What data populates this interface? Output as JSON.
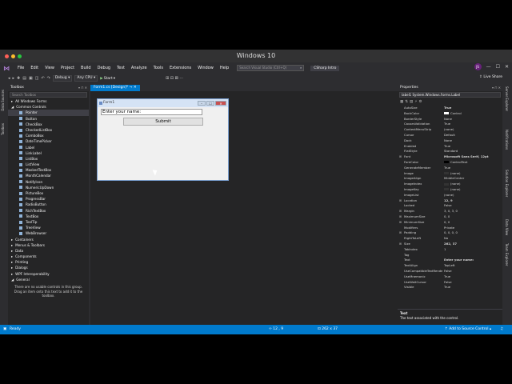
{
  "os": {
    "window_title": "Windows 10"
  },
  "colors": {
    "accent": "#007acc",
    "bg": "#2d2d30",
    "panel": "#252526"
  },
  "menu": {
    "logo_icon": "visual-studio-icon",
    "items": [
      "File",
      "Edit",
      "View",
      "Project",
      "Build",
      "Debug",
      "Test",
      "Analyze",
      "Tools",
      "Extensions",
      "Window",
      "Help"
    ],
    "search_placeholder": "Search Visual Studio (Ctrl+Q)",
    "solution_name": "CSharp Intro",
    "user_initials": "JS",
    "live_share": "Live Share"
  },
  "toolbar": {
    "config": "Debug",
    "platform": "Any CPU",
    "start_label": "Start"
  },
  "left_vertical_tabs": [
    "Data Sources",
    "Toolbox"
  ],
  "toolbox": {
    "title": "Toolbox",
    "search_placeholder": "Search Toolbox",
    "items": [
      {
        "label": "All Windows Forms",
        "level": 0,
        "expander": "▸"
      },
      {
        "label": "Common Controls",
        "level": 0,
        "expander": "◢"
      },
      {
        "label": "Pointer",
        "level": 1,
        "selected": true
      },
      {
        "label": "Button",
        "level": 1
      },
      {
        "label": "CheckBox",
        "level": 1
      },
      {
        "label": "CheckedListBox",
        "level": 1
      },
      {
        "label": "ComboBox",
        "level": 1
      },
      {
        "label": "DateTimePicker",
        "level": 1
      },
      {
        "label": "Label",
        "level": 1
      },
      {
        "label": "LinkLabel",
        "level": 1
      },
      {
        "label": "ListBox",
        "level": 1
      },
      {
        "label": "ListView",
        "level": 1
      },
      {
        "label": "MaskedTextBox",
        "level": 1
      },
      {
        "label": "MonthCalendar",
        "level": 1
      },
      {
        "label": "NotifyIcon",
        "level": 1
      },
      {
        "label": "NumericUpDown",
        "level": 1
      },
      {
        "label": "PictureBox",
        "level": 1
      },
      {
        "label": "ProgressBar",
        "level": 1
      },
      {
        "label": "RadioButton",
        "level": 1
      },
      {
        "label": "RichTextBox",
        "level": 1
      },
      {
        "label": "TextBox",
        "level": 1
      },
      {
        "label": "ToolTip",
        "level": 1
      },
      {
        "label": "TreeView",
        "level": 1
      },
      {
        "label": "WebBrowser",
        "level": 1
      },
      {
        "label": "Containers",
        "level": 0,
        "expander": "▸"
      },
      {
        "label": "Menus & Toolbars",
        "level": 0,
        "expander": "▸"
      },
      {
        "label": "Data",
        "level": 0,
        "expander": "▸"
      },
      {
        "label": "Components",
        "level": 0,
        "expander": "▸"
      },
      {
        "label": "Printing",
        "level": 0,
        "expander": "▸"
      },
      {
        "label": "Dialogs",
        "level": 0,
        "expander": "▸"
      },
      {
        "label": "WPF Interoperability",
        "level": 0,
        "expander": "▸"
      },
      {
        "label": "General",
        "level": 0,
        "expander": "◢"
      }
    ],
    "empty_note": "There are no usable controls in this group. Drag an item onto this text to add it to the toolbox."
  },
  "document": {
    "tab_label": "Form1.cs [Design]*"
  },
  "form": {
    "title": "Form1",
    "label_text": "Enter your name:",
    "button_text": "Submit"
  },
  "right_vertical_tabs": [
    "Server Explorer",
    "Notifications",
    "Solution Explorer",
    "Data View",
    "Team Explorer"
  ],
  "properties": {
    "title": "Properties",
    "selected_object": "label1  System.Windows.Forms.Label",
    "rows": [
      {
        "name": "AutoSize",
        "value": "True",
        "bold": true
      },
      {
        "name": "BackColor",
        "value": "Control",
        "swatch": "#ffffff"
      },
      {
        "name": "BorderStyle",
        "value": "None"
      },
      {
        "name": "CausesValidation",
        "value": "True"
      },
      {
        "name": "ContextMenuStrip",
        "value": "(none)"
      },
      {
        "name": "Cursor",
        "value": "Default"
      },
      {
        "name": "Dock",
        "value": "None"
      },
      {
        "name": "Enabled",
        "value": "True"
      },
      {
        "name": "FlatStyle",
        "value": "Standard"
      },
      {
        "name": "Font",
        "value": "Microsoft Sans Serif, 12pt",
        "bold": true,
        "expander": "⊞"
      },
      {
        "name": "ForeColor",
        "value": "ControlText",
        "swatch": "#000000"
      },
      {
        "name": "GenerateMember",
        "value": "True"
      },
      {
        "name": "Image",
        "value": "(none)",
        "swatch": "#333333"
      },
      {
        "name": "ImageAlign",
        "value": "MiddleCenter"
      },
      {
        "name": "ImageIndex",
        "value": "(none)",
        "swatch": "#333333"
      },
      {
        "name": "ImageKey",
        "value": "(none)",
        "swatch": "#333333"
      },
      {
        "name": "ImageList",
        "value": "(none)"
      },
      {
        "name": "Location",
        "value": "12, 9",
        "bold": true,
        "expander": "⊞"
      },
      {
        "name": "Locked",
        "value": "False"
      },
      {
        "name": "Margin",
        "value": "3, 0, 3, 0",
        "expander": "⊞"
      },
      {
        "name": "MaximumSize",
        "value": "0, 0",
        "expander": "⊞"
      },
      {
        "name": "MinimumSize",
        "value": "0, 0",
        "expander": "⊞"
      },
      {
        "name": "Modifiers",
        "value": "Private"
      },
      {
        "name": "Padding",
        "value": "0, 0, 0, 0",
        "expander": "⊞"
      },
      {
        "name": "RightToLeft",
        "value": "No"
      },
      {
        "name": "Size",
        "value": "262, 37",
        "bold": true,
        "expander": "⊞"
      },
      {
        "name": "TabIndex",
        "value": "1"
      },
      {
        "name": "Tag",
        "value": ""
      },
      {
        "name": "Text",
        "value": "Enter your name:",
        "bold": true
      },
      {
        "name": "TextAlign",
        "value": "TopLeft"
      },
      {
        "name": "UseCompatibleTextRendering",
        "value": "False"
      },
      {
        "name": "UseMnemonic",
        "value": "True"
      },
      {
        "name": "UseWaitCursor",
        "value": "False"
      },
      {
        "name": "Visible",
        "value": "True"
      }
    ],
    "desc_title": "Text",
    "desc_text": "The text associated with the control."
  },
  "status": {
    "state": "Ready",
    "position": "12 , 9",
    "size": "262 x 37",
    "source_control": "Add to Source Control"
  }
}
